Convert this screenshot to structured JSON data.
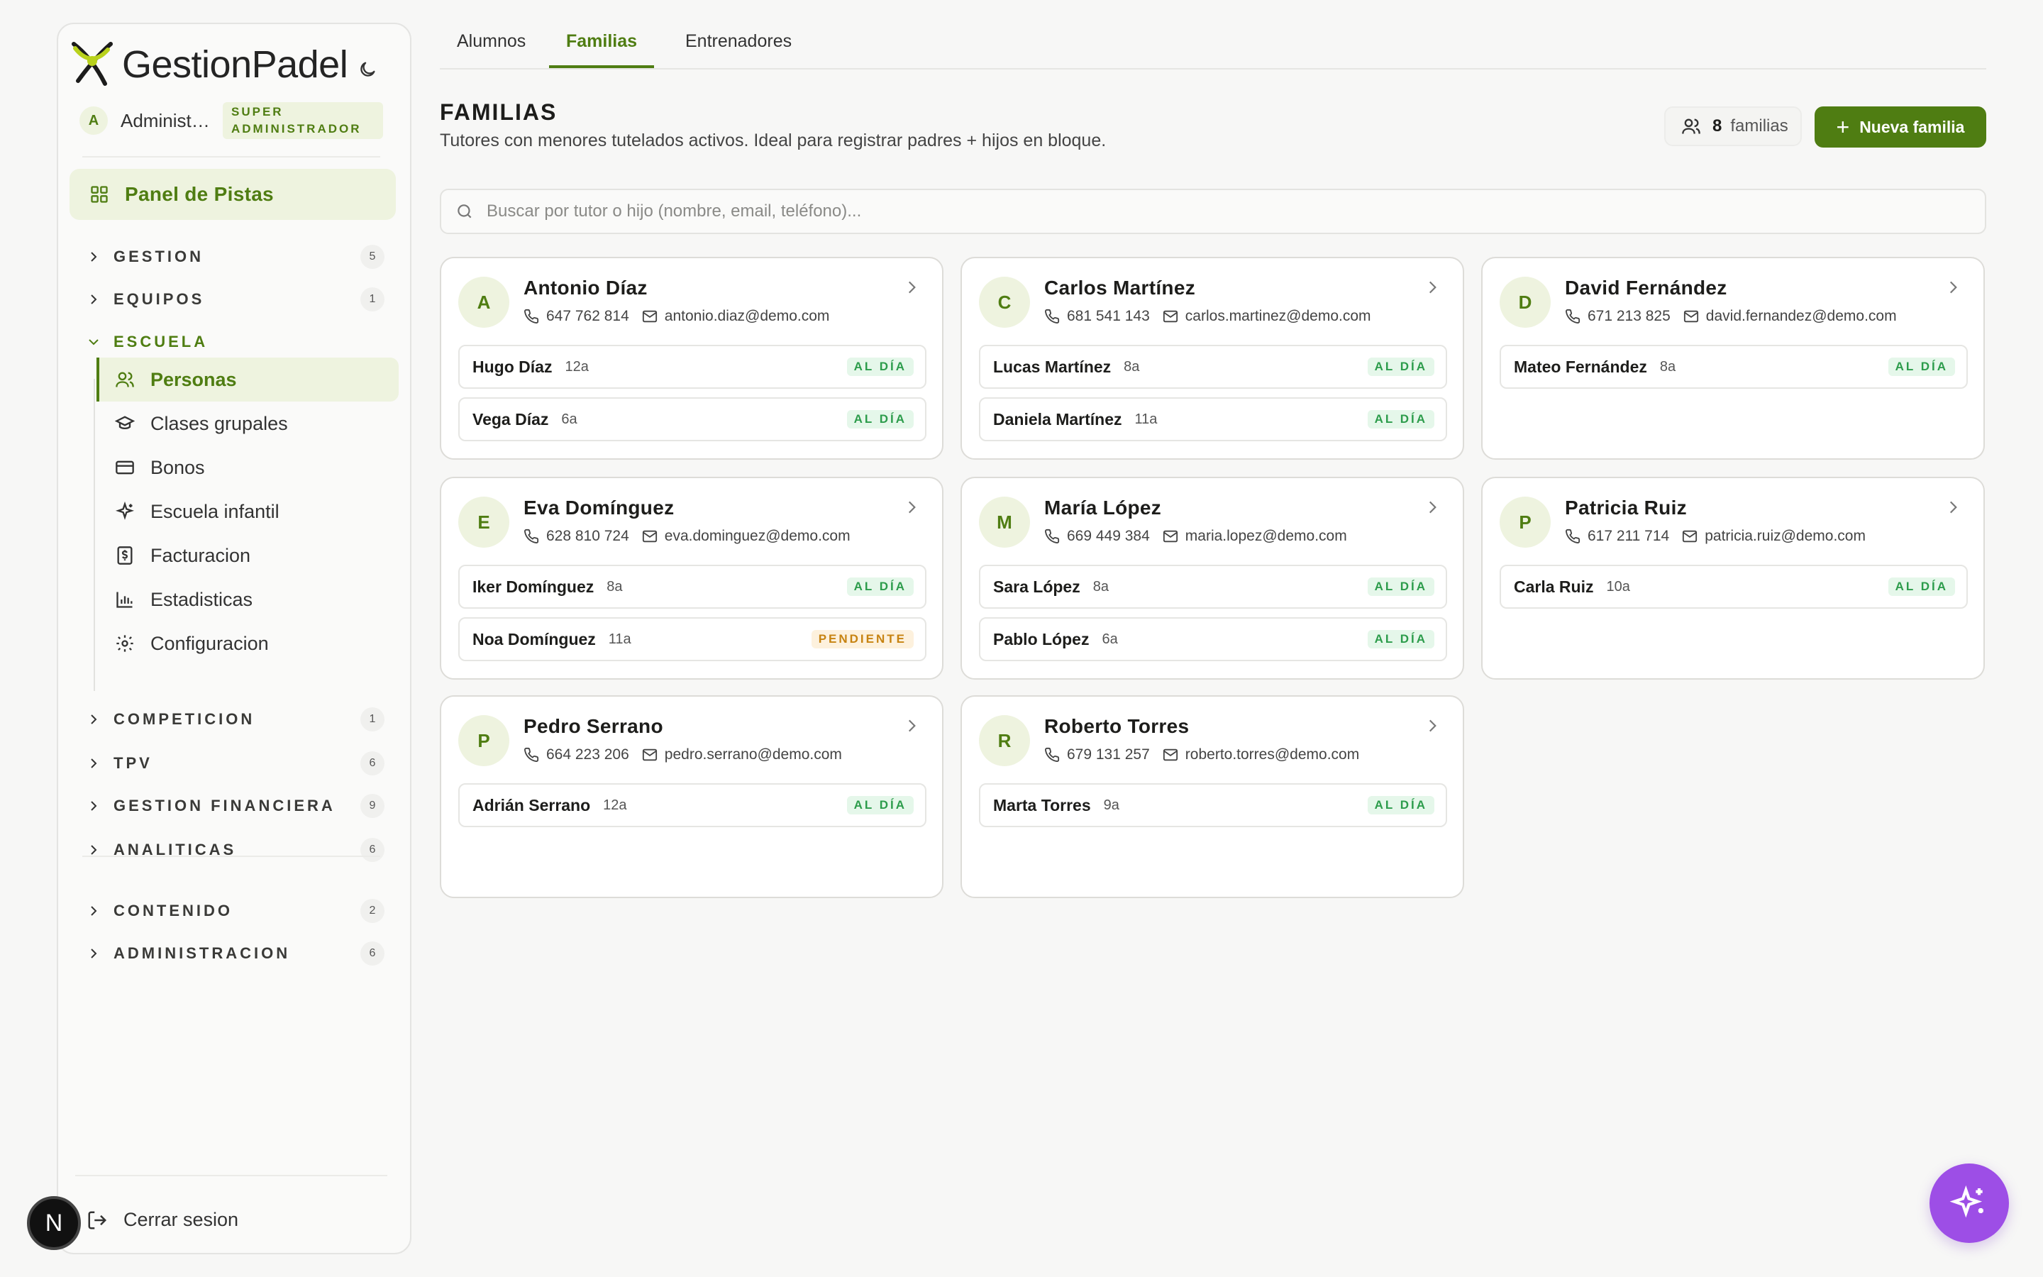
{
  "app": {
    "name": "GestionPadel",
    "user_initial": "A",
    "user_name": "Administrador",
    "user_role": "SUPER ADMINISTRADOR",
    "accent_color": "#4f7d12"
  },
  "sidebar": {
    "panel_label": "Panel de Pistas",
    "sections": [
      {
        "label": "GESTION",
        "count": "5"
      },
      {
        "label": "EQUIPOS",
        "count": "1"
      },
      {
        "label": "ESCUELA"
      },
      {
        "label": "COMPETICION",
        "count": "1"
      },
      {
        "label": "TPV",
        "count": "6"
      },
      {
        "label": "GESTION FINANCIERA",
        "count": "9"
      },
      {
        "label": "ANALITICAS",
        "count": "6"
      },
      {
        "label": "CONTENIDO",
        "count": "2"
      },
      {
        "label": "ADMINISTRACION",
        "count": "6"
      }
    ],
    "escuela_items": [
      {
        "label": "Personas"
      },
      {
        "label": "Clases grupales"
      },
      {
        "label": "Bonos"
      },
      {
        "label": "Escuela infantil"
      },
      {
        "label": "Facturacion"
      },
      {
        "label": "Estadisticas"
      },
      {
        "label": "Configuracion"
      }
    ],
    "logout_label": "Cerrar sesion",
    "n_badge": "N"
  },
  "tabs": [
    {
      "label": "Alumnos"
    },
    {
      "label": "Familias"
    },
    {
      "label": "Entrenadores"
    }
  ],
  "header": {
    "title": "FAMILIAS",
    "subtitle": "Tutores con menores tutelados activos. Ideal para registrar padres + hijos en bloque.",
    "count": "8",
    "count_label": "familias",
    "new_button": "Nueva familia",
    "search_placeholder": "Buscar por tutor o hijo (nombre, email, teléfono)..."
  },
  "families": [
    {
      "initial": "A",
      "name": "Antonio Díaz",
      "phone": "647 762 814",
      "email": "antonio.diaz@demo.com",
      "children": [
        {
          "name": "Hugo Díaz",
          "age": "12a",
          "status": "AL DÍA"
        },
        {
          "name": "Vega Díaz",
          "age": "6a",
          "status": "AL DÍA"
        }
      ]
    },
    {
      "initial": "C",
      "name": "Carlos Martínez",
      "phone": "681 541 143",
      "email": "carlos.martinez@demo.com",
      "children": [
        {
          "name": "Lucas Martínez",
          "age": "8a",
          "status": "AL DÍA"
        },
        {
          "name": "Daniela Martínez",
          "age": "11a",
          "status": "AL DÍA"
        }
      ]
    },
    {
      "initial": "D",
      "name": "David Fernández",
      "phone": "671 213 825",
      "email": "david.fernandez@demo.com",
      "children": [
        {
          "name": "Mateo Fernández",
          "age": "8a",
          "status": "AL DÍA"
        }
      ]
    },
    {
      "initial": "E",
      "name": "Eva Domínguez",
      "phone": "628 810 724",
      "email": "eva.dominguez@demo.com",
      "children": [
        {
          "name": "Iker Domínguez",
          "age": "8a",
          "status": "AL DÍA"
        },
        {
          "name": "Noa Domínguez",
          "age": "11a",
          "status": "PENDIENTE"
        }
      ]
    },
    {
      "initial": "M",
      "name": "María López",
      "phone": "669 449 384",
      "email": "maria.lopez@demo.com",
      "children": [
        {
          "name": "Sara López",
          "age": "8a",
          "status": "AL DÍA"
        },
        {
          "name": "Pablo López",
          "age": "6a",
          "status": "AL DÍA"
        }
      ]
    },
    {
      "initial": "P",
      "name": "Patricia Ruiz",
      "phone": "617 211 714",
      "email": "patricia.ruiz@demo.com",
      "children": [
        {
          "name": "Carla Ruiz",
          "age": "10a",
          "status": "AL DÍA"
        }
      ]
    },
    {
      "initial": "P",
      "name": "Pedro Serrano",
      "phone": "664 223 206",
      "email": "pedro.serrano@demo.com",
      "children": [
        {
          "name": "Adrián Serrano",
          "age": "12a",
          "status": "AL DÍA"
        }
      ]
    },
    {
      "initial": "R",
      "name": "Roberto Torres",
      "phone": "679 131 257",
      "email": "roberto.torres@demo.com",
      "children": [
        {
          "name": "Marta Torres",
          "age": "9a",
          "status": "AL DÍA"
        }
      ]
    }
  ]
}
